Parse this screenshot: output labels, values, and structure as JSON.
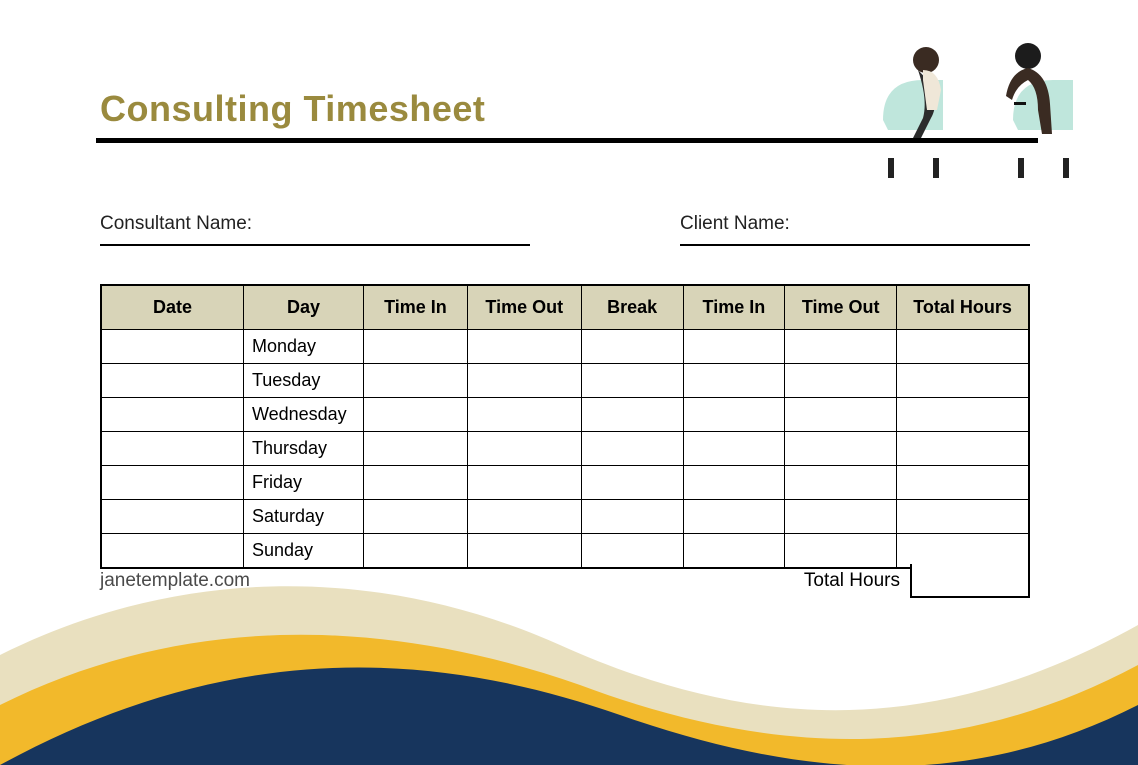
{
  "title": "Consulting Timesheet",
  "fields": {
    "consultant_label": "Consultant Name:",
    "client_label": "Client Name:"
  },
  "table": {
    "headers": [
      "Date",
      "Day",
      "Time In",
      "Time Out",
      "Break",
      "Time In",
      "Time Out",
      "Total Hours"
    ],
    "rows": [
      {
        "date": "",
        "day": "Monday",
        "in1": "",
        "out1": "",
        "break": "",
        "in2": "",
        "out2": "",
        "total": ""
      },
      {
        "date": "",
        "day": "Tuesday",
        "in1": "",
        "out1": "",
        "break": "",
        "in2": "",
        "out2": "",
        "total": ""
      },
      {
        "date": "",
        "day": "Wednesday",
        "in1": "",
        "out1": "",
        "break": "",
        "in2": "",
        "out2": "",
        "total": ""
      },
      {
        "date": "",
        "day": "Thursday",
        "in1": "",
        "out1": "",
        "break": "",
        "in2": "",
        "out2": "",
        "total": ""
      },
      {
        "date": "",
        "day": "Friday",
        "in1": "",
        "out1": "",
        "break": "",
        "in2": "",
        "out2": "",
        "total": ""
      },
      {
        "date": "",
        "day": "Saturday",
        "in1": "",
        "out1": "",
        "break": "",
        "in2": "",
        "out2": "",
        "total": ""
      },
      {
        "date": "",
        "day": "Sunday",
        "in1": "",
        "out1": "",
        "break": "",
        "in2": "",
        "out2": "",
        "total": ""
      }
    ]
  },
  "footer": {
    "site": "janetemplate.com",
    "total_label": "Total Hours",
    "total_value": ""
  }
}
